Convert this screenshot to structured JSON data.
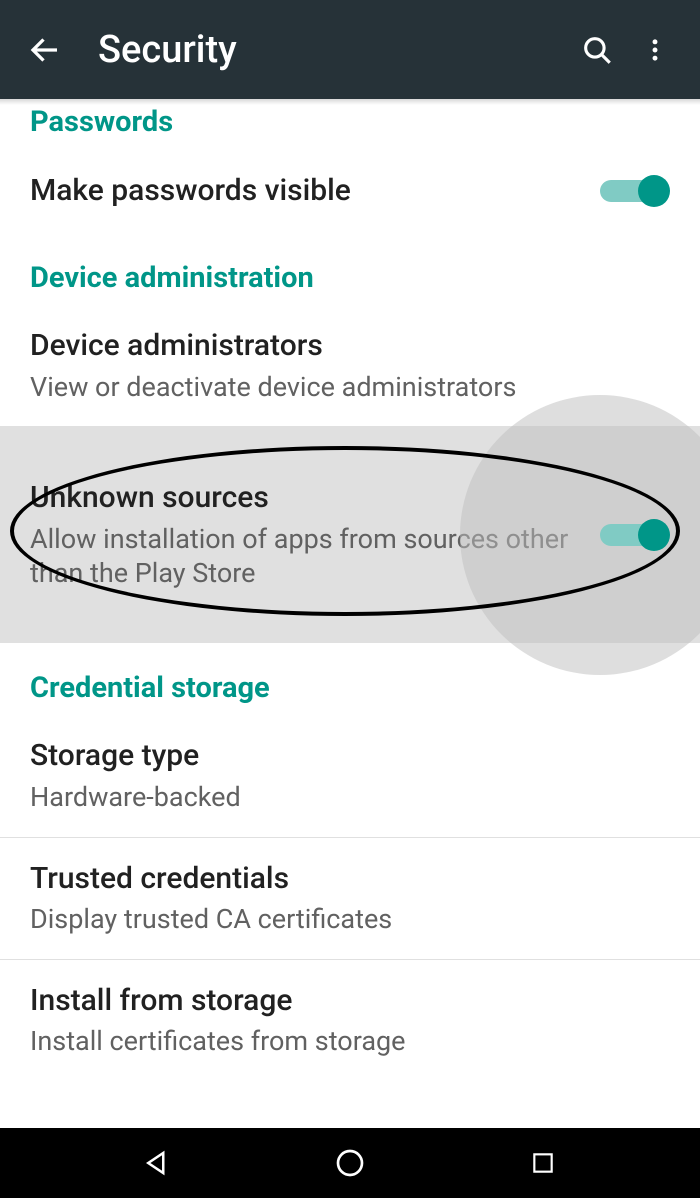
{
  "header": {
    "title": "Security"
  },
  "sections": {
    "passwords": {
      "header": "Passwords"
    },
    "device_admin": {
      "header": "Device administration"
    },
    "credential_storage": {
      "header": "Credential storage"
    }
  },
  "items": {
    "make_passwords_visible": {
      "title": "Make passwords visible",
      "toggle": true
    },
    "device_administrators": {
      "title": "Device administrators",
      "subtitle": "View or deactivate device administrators"
    },
    "unknown_sources": {
      "title": "Unknown sources",
      "subtitle": "Allow installation of apps from sources other than the Play Store",
      "toggle": true
    },
    "storage_type": {
      "title": "Storage type",
      "subtitle": "Hardware-backed"
    },
    "trusted_credentials": {
      "title": "Trusted credentials",
      "subtitle": "Display trusted CA certificates"
    },
    "install_from_storage": {
      "title": "Install from storage",
      "subtitle": "Install certificates from storage"
    }
  },
  "colors": {
    "accent": "#009688",
    "appbar": "#263238"
  }
}
